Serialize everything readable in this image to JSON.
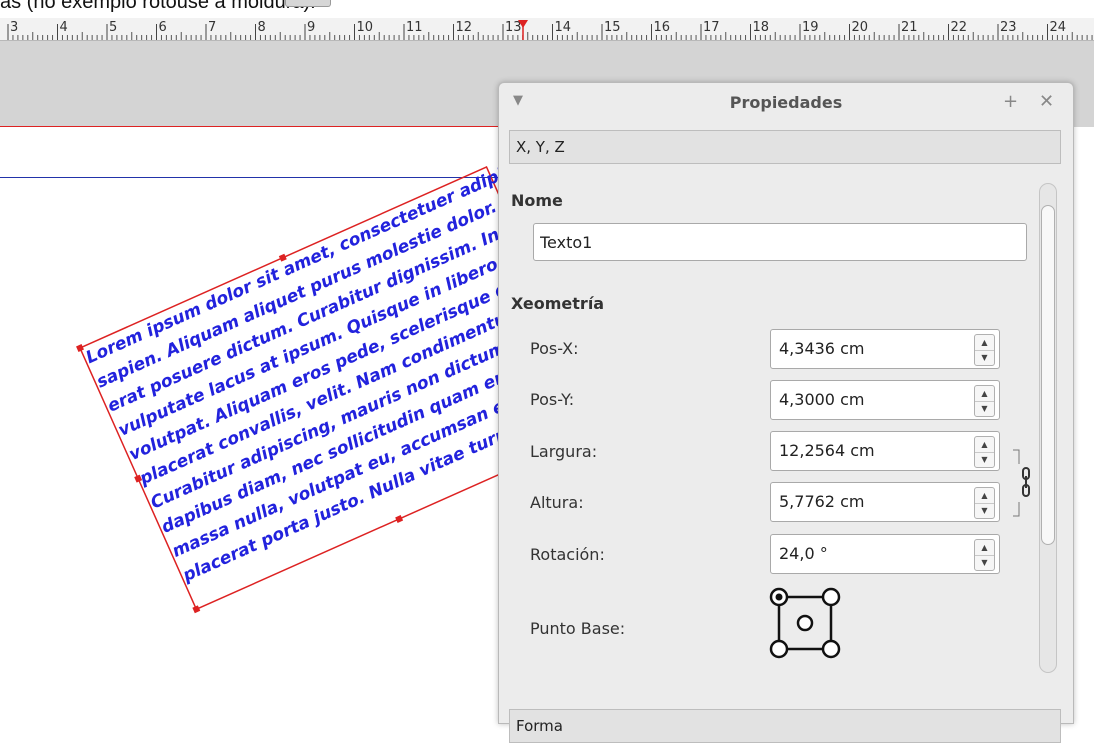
{
  "caption": "as (no exemplo rotouse a moldura).",
  "ruler": {
    "labels": [
      "3",
      "4",
      "5",
      "6",
      "7",
      "8",
      "9",
      "10",
      "11",
      "12",
      "13",
      "14",
      "15",
      "16",
      "17",
      "18",
      "19",
      "20",
      "21",
      "22",
      "23",
      "24"
    ]
  },
  "canvas_text": {
    "lines": [
      "Lorem ipsum dolor sit amet, consectetuer adipisc",
      "sapien. Aliquam aliquet purus molestie dolor. In",
      "erat posuere dictum. Curabitur dignissim. Inte",
      "vulputate lacus at ipsum. Quisque in libero ne",
      "volutpat. Aliquam eros pede, scelerisque qu",
      "placerat convallis, velit. Nam condimentum",
      "Curabitur adipiscing, mauris non dictum e",
      "dapibus diam, nec sollicitudin quam era",
      "massa nulla, volutpat eu, accumsan et.",
      "placerat porta justo. Nulla vitae turpi"
    ],
    "text_color": "#2222dd",
    "frame_color": "#dd2222"
  },
  "panel": {
    "title": "Propiedades",
    "collapse_icon": "triangle-down-icon",
    "add_icon": "plus-icon",
    "close_icon": "close-icon",
    "section_xyz": "X, Y, Z",
    "name_heading": "Nome",
    "name_value": "Texto1",
    "geometry_heading": "Xeometría",
    "fields": [
      {
        "label": "Pos-X:",
        "value": "4,3436 cm"
      },
      {
        "label": "Pos-Y:",
        "value": "4,3000 cm"
      },
      {
        "label": "Largura:",
        "value": "12,2564 cm"
      },
      {
        "label": "Altura:",
        "value": "5,7762 cm"
      },
      {
        "label": "Rotación:",
        "value": "24,0 °"
      }
    ],
    "base_point_label": "Punto Base:",
    "section_shape": "Forma"
  }
}
